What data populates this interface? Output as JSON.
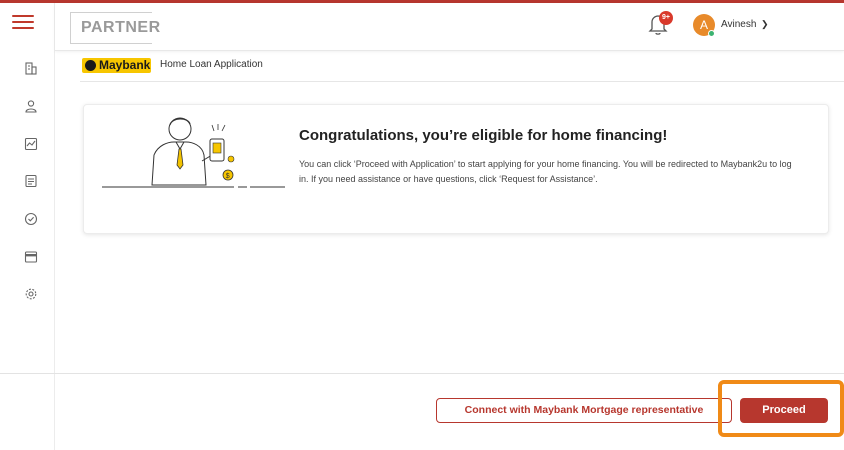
{
  "header": {
    "partner_label": "PARTNER",
    "notification_badge": "9+",
    "avatar_initial": "A",
    "user_name": "Avinesh"
  },
  "brand": {
    "logo_text": "Maybank",
    "breadcrumb": "Home Loan Application"
  },
  "card": {
    "title": "Congratulations, you’re eligible for home financing!",
    "body": "You can click ‘Proceed with Application’ to start applying for your home financing. You will be redirected to Maybank2u to log in. If you need assistance or have questions, click ‘Request for Assistance’."
  },
  "footer": {
    "connect_label": "Connect with Maybank Mortgage representative",
    "proceed_label": "Proceed"
  },
  "sidebar": {
    "icons": [
      "building-icon",
      "user-icon",
      "chart-icon",
      "document-icon",
      "check-circle-icon",
      "card-icon",
      "gear-icon"
    ]
  },
  "colors": {
    "brand_red": "#b7372e",
    "maybank_yellow": "#f7c600",
    "highlight_orange": "#f08a17",
    "avatar_orange": "#e88a2a"
  }
}
